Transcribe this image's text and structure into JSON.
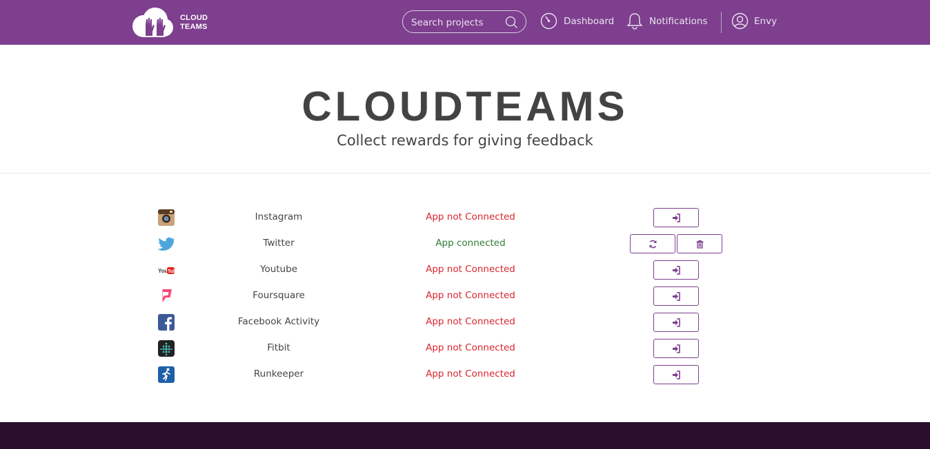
{
  "header": {
    "logo_line1": "CLOUD",
    "logo_line2": "TEAMS",
    "search_placeholder": "Search projects",
    "nav": {
      "dashboard": "Dashboard",
      "notifications": "Notifications",
      "user": "Envy"
    }
  },
  "hero": {
    "title": "CLOUDTEAMS",
    "subtitle": "Collect rewards for giving feedback"
  },
  "apps": [
    {
      "name": "Instagram",
      "status": "App not Connected",
      "icon": "instagram-icon"
    },
    {
      "name": "Twitter",
      "status": "App connected",
      "icon": "twitter-icon"
    },
    {
      "name": "Youtube",
      "status": "App not Connected",
      "icon": "youtube-icon"
    },
    {
      "name": "Foursquare",
      "status": "App not Connected",
      "icon": "foursquare-icon"
    },
    {
      "name": "Facebook Activity",
      "status": "App not Connected",
      "icon": "facebook-icon"
    },
    {
      "name": "Fitbit",
      "status": "App not Connected",
      "icon": "fitbit-icon"
    },
    {
      "name": "Runkeeper",
      "status": "App not Connected",
      "icon": "runkeeper-icon"
    }
  ],
  "colors": {
    "brand": "#7d3f8e",
    "footer": "#2b0e2b",
    "not_connected": "#d9252f",
    "connected": "#2e7d32"
  }
}
